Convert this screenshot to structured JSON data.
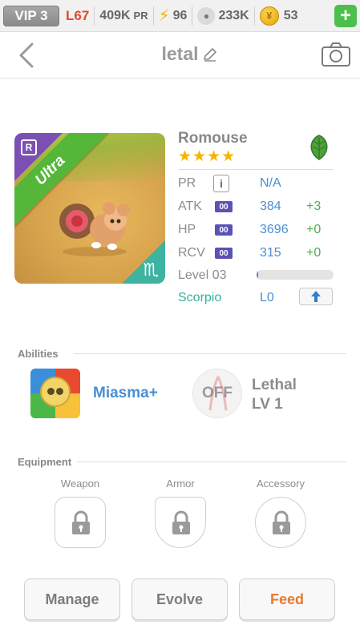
{
  "statusbar": {
    "vip": "VIP 3",
    "level": "L67",
    "power": "409K",
    "power_unit": "PR",
    "energy": "96",
    "food": "233K",
    "coins": "53",
    "add_label": "+"
  },
  "header": {
    "title": "letal"
  },
  "monster": {
    "name": "Romouse",
    "stars": "★★★★",
    "rarity_letter": "R",
    "rarity": "Ultra",
    "zodiac_symbol": "♏",
    "stats": {
      "pr_label": "PR",
      "pr_value": "N/A",
      "info_glyph": "i",
      "atk_label": "ATK",
      "atk_tag": "00",
      "atk_value": "384",
      "atk_bonus": "+3",
      "hp_label": "HP",
      "hp_tag": "00",
      "hp_value": "3696",
      "hp_bonus": "+0",
      "rcv_label": "RCV",
      "rcv_tag": "00",
      "rcv_value": "315",
      "rcv_bonus": "+0",
      "level_label": "Level 03",
      "xp_progress": 0.02,
      "zodiac_name": "Scorpio",
      "zodiac_level": "L0"
    }
  },
  "abilities": {
    "section_label": "Abilities",
    "ability_1": {
      "name": "Miasma+"
    },
    "ability_2": {
      "state": "OFF",
      "name": "Lethal",
      "level": "LV 1"
    }
  },
  "equipment": {
    "section_label": "Equipment",
    "weapon": "Weapon",
    "armor": "Armor",
    "accessory": "Accessory"
  },
  "actions": {
    "manage": "Manage",
    "evolve": "Evolve",
    "feed": "Feed"
  },
  "colors": {
    "accent_blue": "#4a8fd1",
    "bonus_green": "#4fae4f",
    "feed_orange": "#e77a2e",
    "ultra_green": "#54b73a",
    "zodiac_teal": "#35b09e"
  }
}
